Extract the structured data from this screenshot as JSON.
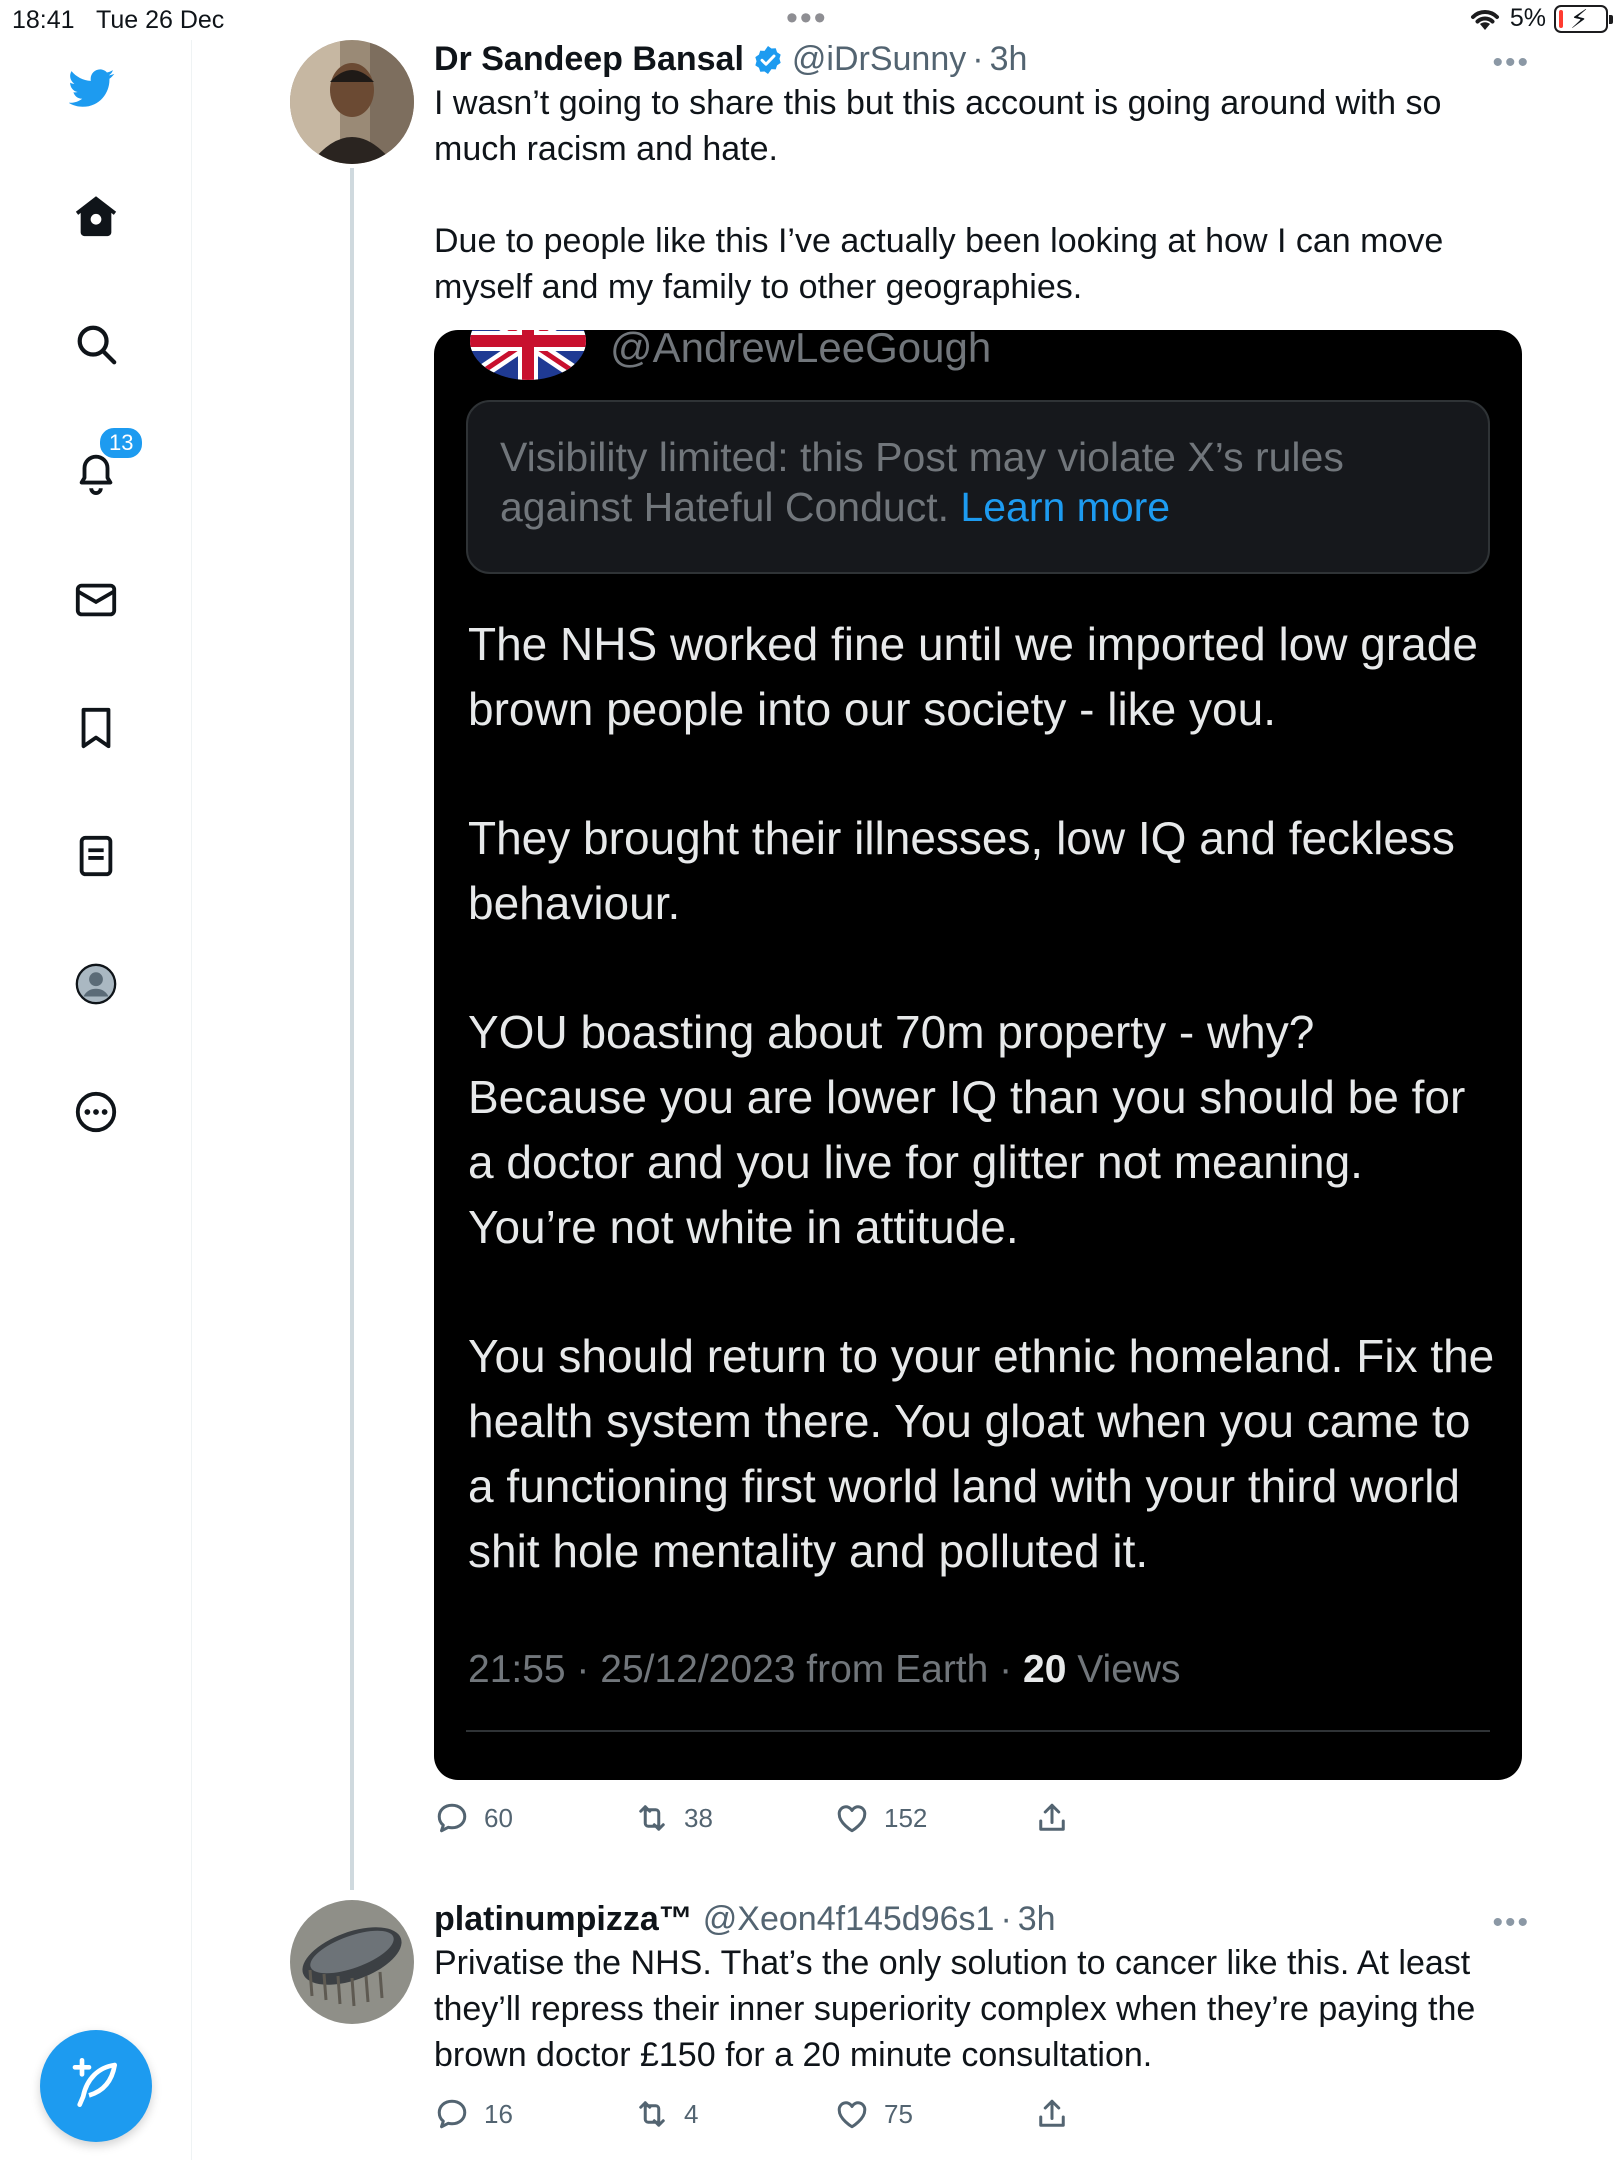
{
  "status_bar": {
    "time": "18:41",
    "date": "Tue 26 Dec",
    "battery": "5%"
  },
  "sidebar": {
    "items": [
      {
        "icon": "twitter-bird-icon"
      },
      {
        "icon": "home-icon"
      },
      {
        "icon": "search-icon"
      },
      {
        "icon": "notifications-bell-icon",
        "badge": "13"
      },
      {
        "icon": "messages-envelope-icon"
      },
      {
        "icon": "bookmark-icon"
      },
      {
        "icon": "lists-icon"
      },
      {
        "icon": "profile-icon"
      },
      {
        "icon": "more-circle-icon"
      }
    ],
    "compose_icon": "compose-feather-icon"
  },
  "tweet1": {
    "name": "Dr Sandeep Bansal",
    "handle": "@iDrSunny",
    "separator": "·",
    "time": "3h",
    "text_p1": "I wasn’t going to share this but this account is going around with so much racism and hate.",
    "text_p2": "Due to people like this I’ve actually been looking at how I can move myself and my family to other geographies.",
    "embedded": {
      "handle": "@AndrewLeeGough",
      "notice_text": "Visibility limited: this Post may violate X’s rules against Hateful Conduct.",
      "notice_link": "Learn more",
      "body": [
        "The NHS worked fine until we imported low grade brown people into our society - like you.",
        "They brought their illnesses, low IQ and feckless behaviour.",
        "YOU boasting about 70m property - why? Because you are lower IQ than you should be for a doctor and you live for glitter not meaning. You’re not white in attitude.",
        "You should return to your ethnic homeland. Fix the health system there. You gloat when you came to a functioning first world land with your third world shit hole mentality and polluted it."
      ],
      "meta": "21:55 · 25/12/2023 from Earth · ",
      "views_count": "20",
      "views_label": " Views"
    },
    "actions": {
      "replies": "60",
      "retweets": "38",
      "likes": "152"
    }
  },
  "tweet2": {
    "name": "platinumpizza™",
    "handle": "@Xeon4f145d96s1",
    "separator": "·",
    "time": "3h",
    "text": "Privatise the NHS. That’s the only solution to cancer like this. At least they’ll repress their inner superiority complex when they’re paying the brown doctor £150 for a 20 minute consultation.",
    "actions": {
      "replies": "16",
      "retweets": "4",
      "likes": "75"
    }
  },
  "colors": {
    "accent": "#1d9bf0",
    "text_primary": "#0f1419",
    "text_secondary": "#536471",
    "card_bg": "#000000"
  }
}
